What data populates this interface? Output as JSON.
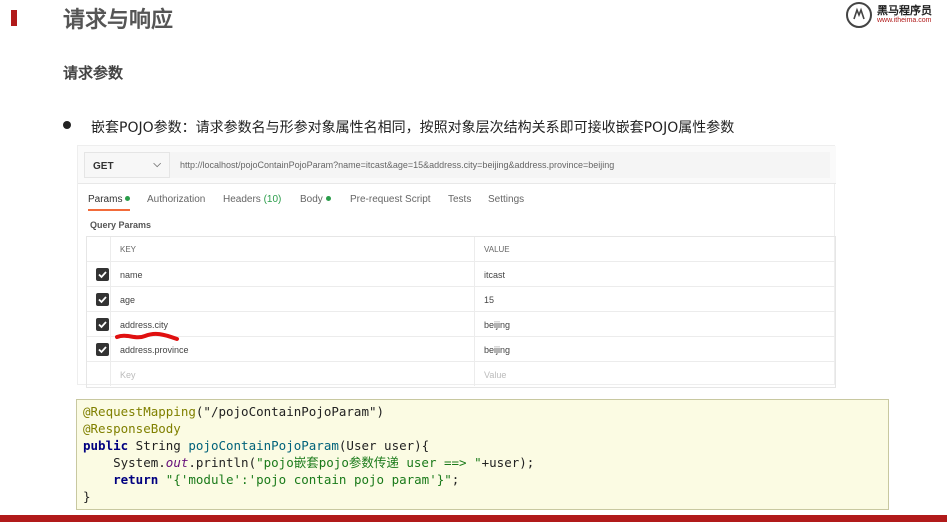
{
  "slide": {
    "title": "请求与响应",
    "section": "请求参数",
    "bullet": "嵌套POJO参数：请求参数名与形参对象属性名相同，按照对象层次结构关系即可接收嵌套POJO属性参数"
  },
  "logo": {
    "name": "黑马程序员",
    "url": "www.itheima.com"
  },
  "postman": {
    "method": "GET",
    "url": "http://localhost/pojoContainPojoParam?name=itcast&age=15&address.city=beijing&address.province=beijing",
    "tabs": {
      "params": "Params",
      "authorization": "Authorization",
      "headers": "Headers",
      "headers_count": "(10)",
      "body": "Body",
      "prerequest": "Pre-request Script",
      "tests": "Tests",
      "settings": "Settings"
    },
    "query_label": "Query Params",
    "columns": {
      "key": "KEY",
      "value": "VALUE"
    },
    "rows": [
      {
        "key": "name",
        "value": "itcast",
        "checked": true
      },
      {
        "key": "age",
        "value": "15",
        "checked": true
      },
      {
        "key": "address.city",
        "value": "beijing",
        "checked": true
      },
      {
        "key": "address.province",
        "value": "beijing",
        "checked": true
      }
    ],
    "placeholder": {
      "key": "Key",
      "value": "Value"
    }
  },
  "code": {
    "line1_ann": "@RequestMapping",
    "line1_rest": "(\"/pojoContainPojoParam\")",
    "line2_ann": "@ResponseBody",
    "line3_kw": "public",
    "line3_type": " String ",
    "line3_fn": "pojoContainPojoParam",
    "line3_rest": "(User user){",
    "line4_a": "    System.",
    "line4_out": "out",
    "line4_b": ".println(",
    "line4_str": "\"pojo嵌套pojo参数传递 user ==> \"",
    "line4_c": "+user);",
    "line5_kw": "    return ",
    "line5_str": "\"{'module':'pojo contain pojo param'}\"",
    "line5_c": ";",
    "line6": "}"
  },
  "colors": {
    "accent": "#b11a1a",
    "code_bg": "#fbfbe3",
    "tab_active": "#f26b3a",
    "dot_green": "#2a9d4a",
    "underline_red": "#e01010"
  }
}
